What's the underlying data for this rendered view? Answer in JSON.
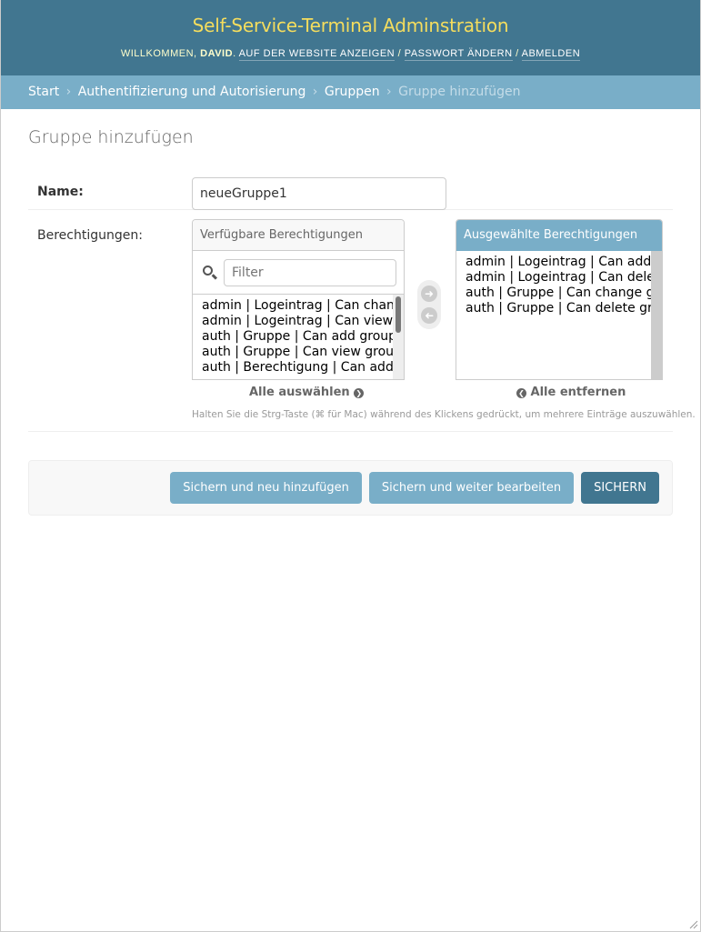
{
  "header": {
    "site_name": "Self-Service-Terminal Adminstration",
    "welcome": "Willkommen,",
    "user": "David",
    "view_site": "Auf der Website anzeigen",
    "change_password": "Passwort ändern",
    "logout": "Abmelden",
    "separator": "/"
  },
  "breadcrumbs": {
    "items": [
      "Start",
      "Authentifizierung und Autorisierung",
      "Gruppen"
    ],
    "current": "Gruppe hinzufügen",
    "separator": "›"
  },
  "page_title": "Gruppe hinzufügen",
  "form": {
    "name_label": "Name:",
    "name_value": "neueGruppe1",
    "permissions_label": "Berechtigungen:"
  },
  "selector": {
    "available_title": "Verfügbare Berechtigungen",
    "filter_placeholder": "Filter",
    "available": [
      "admin | Logeintrag | Can change log entry",
      "admin | Logeintrag | Can view log entry",
      "auth | Gruppe | Can add group",
      "auth | Gruppe | Can view group",
      "auth | Berechtigung | Can add permission"
    ],
    "chosen_title": "Ausgewählte Berechtigungen",
    "chosen": [
      "admin | Logeintrag | Can add log entry",
      "admin | Logeintrag | Can delete log entry",
      "auth | Gruppe | Can change group",
      "auth | Gruppe | Can delete group"
    ],
    "choose_all": "Alle auswählen",
    "remove_all": "Alle entfernen",
    "help": "Halten Sie die Strg-Taste (⌘ für Mac) während des Klickens gedrückt, um mehrere Einträge auszuwählen."
  },
  "buttons": {
    "save_add": "Sichern und neu hinzufügen",
    "save_continue": "Sichern und weiter bearbeiten",
    "save": "Sichern"
  },
  "colors": {
    "header_bg": "#417690",
    "site_name": "#f5dd5d",
    "breadcrumbs_bg": "#79aec8",
    "primary_button": "#417690",
    "secondary_button": "#79aec8"
  }
}
